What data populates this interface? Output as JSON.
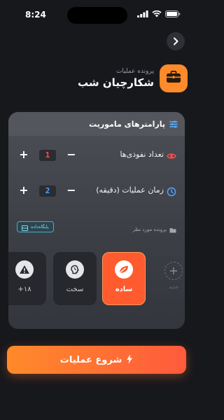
{
  "status": {
    "time": "8:24"
  },
  "header": {
    "subtitle": "پرونده عملیات",
    "title": "شکارچیان شب"
  },
  "params": {
    "title": "پارامترهای ماموریت",
    "infiltrators": {
      "label": "تعداد نفوذی‌ها",
      "value": "1"
    },
    "duration": {
      "label": "زمان عملیات (دقیقه)",
      "value": "2"
    }
  },
  "files": {
    "knowledge_base": "پایگاه‌داده",
    "target_file": "پرونده مورد نظر"
  },
  "difficulty": {
    "selected": "easy",
    "options": [
      {
        "id": "easy",
        "label": "ساده"
      },
      {
        "id": "hard",
        "label": "سخت"
      },
      {
        "id": "extreme",
        "label": "+۱۸"
      },
      {
        "id": "custom",
        "label": "جدید"
      }
    ]
  },
  "start_button": {
    "label": "شروع عملیات"
  },
  "colors": {
    "accent": "#ff8a2a",
    "danger": "#ff4d4d",
    "info": "#4da3ff"
  }
}
